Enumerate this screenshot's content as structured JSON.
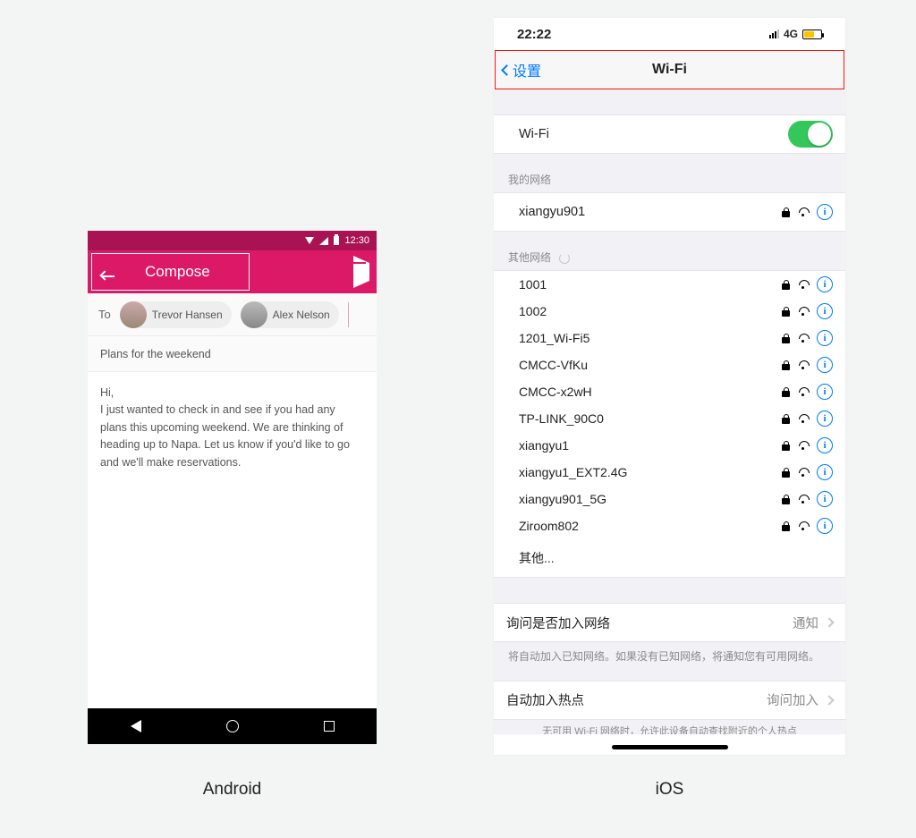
{
  "captions": {
    "android": "Android",
    "ios": "iOS"
  },
  "android": {
    "status": {
      "time": "12:30"
    },
    "appbar": {
      "title": "Compose"
    },
    "to_label": "To",
    "recipients": [
      {
        "name": "Trevor Hansen"
      },
      {
        "name": "Alex Nelson"
      }
    ],
    "subject": "Plans for the weekend",
    "body_greeting": "Hi,",
    "body_text": "I just wanted to check in and see if you had any plans this upcoming weekend. We are thinking of heading up to Napa. Let us know if you'd like to go and we'll make reservations."
  },
  "ios": {
    "status": {
      "time": "22:22",
      "net": "4G"
    },
    "nav": {
      "back": "设置",
      "title": "Wi-Fi"
    },
    "wifi_toggle": {
      "label": "Wi-Fi",
      "on": true
    },
    "section_my": "我的网络",
    "my_networks": [
      {
        "name": "xiangyu901",
        "locked": true
      }
    ],
    "section_other": "其他网络",
    "other_networks": [
      {
        "name": "1001",
        "locked": true
      },
      {
        "name": "1002",
        "locked": true
      },
      {
        "name": "1201_Wi-Fi5",
        "locked": true
      },
      {
        "name": "CMCC-VfKu",
        "locked": true
      },
      {
        "name": "CMCC-x2wH",
        "locked": true
      },
      {
        "name": "TP-LINK_90C0",
        "locked": true
      },
      {
        "name": "xiangyu1",
        "locked": true
      },
      {
        "name": "xiangyu1_EXT2.4G",
        "locked": true
      },
      {
        "name": "xiangyu901_5G",
        "locked": true
      },
      {
        "name": "Ziroom802",
        "locked": true
      }
    ],
    "other_label": "其他...",
    "ask_join": {
      "label": "询问是否加入网络",
      "value": "通知"
    },
    "ask_join_note": "将自动加入已知网络。如果没有已知网络，将通知您有可用网络。",
    "auto_hotspot": {
      "label": "自动加入热点",
      "value": "询问加入"
    },
    "clipped_note": "无可用 Wi-Fi 网络时，允许此设备自动查找附近的个人热点"
  }
}
